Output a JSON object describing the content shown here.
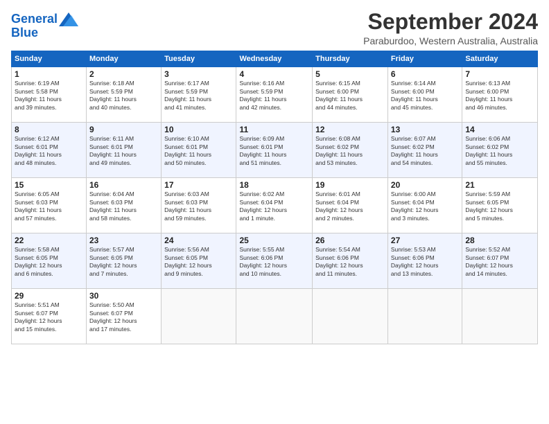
{
  "logo": {
    "line1": "General",
    "line2": "Blue"
  },
  "header": {
    "month": "September 2024",
    "location": "Paraburdoo, Western Australia, Australia"
  },
  "weekdays": [
    "Sunday",
    "Monday",
    "Tuesday",
    "Wednesday",
    "Thursday",
    "Friday",
    "Saturday"
  ],
  "weeks": [
    [
      {
        "day": "1",
        "rise": "6:19 AM",
        "set": "5:58 PM",
        "daylight": "11 hours and 39 minutes."
      },
      {
        "day": "2",
        "rise": "6:18 AM",
        "set": "5:59 PM",
        "daylight": "11 hours and 40 minutes."
      },
      {
        "day": "3",
        "rise": "6:17 AM",
        "set": "5:59 PM",
        "daylight": "11 hours and 41 minutes."
      },
      {
        "day": "4",
        "rise": "6:16 AM",
        "set": "5:59 PM",
        "daylight": "11 hours and 42 minutes."
      },
      {
        "day": "5",
        "rise": "6:15 AM",
        "set": "6:00 PM",
        "daylight": "11 hours and 44 minutes."
      },
      {
        "day": "6",
        "rise": "6:14 AM",
        "set": "6:00 PM",
        "daylight": "11 hours and 45 minutes."
      },
      {
        "day": "7",
        "rise": "6:13 AM",
        "set": "6:00 PM",
        "daylight": "11 hours and 46 minutes."
      }
    ],
    [
      {
        "day": "8",
        "rise": "6:12 AM",
        "set": "6:01 PM",
        "daylight": "11 hours and 48 minutes."
      },
      {
        "day": "9",
        "rise": "6:11 AM",
        "set": "6:01 PM",
        "daylight": "11 hours and 49 minutes."
      },
      {
        "day": "10",
        "rise": "6:10 AM",
        "set": "6:01 PM",
        "daylight": "11 hours and 50 minutes."
      },
      {
        "day": "11",
        "rise": "6:09 AM",
        "set": "6:01 PM",
        "daylight": "11 hours and 51 minutes."
      },
      {
        "day": "12",
        "rise": "6:08 AM",
        "set": "6:02 PM",
        "daylight": "11 hours and 53 minutes."
      },
      {
        "day": "13",
        "rise": "6:07 AM",
        "set": "6:02 PM",
        "daylight": "11 hours and 54 minutes."
      },
      {
        "day": "14",
        "rise": "6:06 AM",
        "set": "6:02 PM",
        "daylight": "11 hours and 55 minutes."
      }
    ],
    [
      {
        "day": "15",
        "rise": "6:05 AM",
        "set": "6:03 PM",
        "daylight": "11 hours and 57 minutes."
      },
      {
        "day": "16",
        "rise": "6:04 AM",
        "set": "6:03 PM",
        "daylight": "11 hours and 58 minutes."
      },
      {
        "day": "17",
        "rise": "6:03 AM",
        "set": "6:03 PM",
        "daylight": "11 hours and 59 minutes."
      },
      {
        "day": "18",
        "rise": "6:02 AM",
        "set": "6:04 PM",
        "daylight": "12 hours and 1 minute."
      },
      {
        "day": "19",
        "rise": "6:01 AM",
        "set": "6:04 PM",
        "daylight": "12 hours and 2 minutes."
      },
      {
        "day": "20",
        "rise": "6:00 AM",
        "set": "6:04 PM",
        "daylight": "12 hours and 3 minutes."
      },
      {
        "day": "21",
        "rise": "5:59 AM",
        "set": "6:05 PM",
        "daylight": "12 hours and 5 minutes."
      }
    ],
    [
      {
        "day": "22",
        "rise": "5:58 AM",
        "set": "6:05 PM",
        "daylight": "12 hours and 6 minutes."
      },
      {
        "day": "23",
        "rise": "5:57 AM",
        "set": "6:05 PM",
        "daylight": "12 hours and 7 minutes."
      },
      {
        "day": "24",
        "rise": "5:56 AM",
        "set": "6:05 PM",
        "daylight": "12 hours and 9 minutes."
      },
      {
        "day": "25",
        "rise": "5:55 AM",
        "set": "6:06 PM",
        "daylight": "12 hours and 10 minutes."
      },
      {
        "day": "26",
        "rise": "5:54 AM",
        "set": "6:06 PM",
        "daylight": "12 hours and 11 minutes."
      },
      {
        "day": "27",
        "rise": "5:53 AM",
        "set": "6:06 PM",
        "daylight": "12 hours and 13 minutes."
      },
      {
        "day": "28",
        "rise": "5:52 AM",
        "set": "6:07 PM",
        "daylight": "12 hours and 14 minutes."
      }
    ],
    [
      {
        "day": "29",
        "rise": "5:51 AM",
        "set": "6:07 PM",
        "daylight": "12 hours and 15 minutes."
      },
      {
        "day": "30",
        "rise": "5:50 AM",
        "set": "6:07 PM",
        "daylight": "12 hours and 17 minutes."
      },
      null,
      null,
      null,
      null,
      null
    ]
  ]
}
